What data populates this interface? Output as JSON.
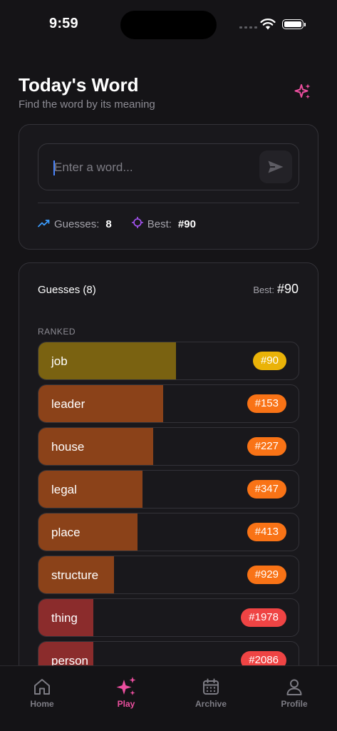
{
  "status": {
    "time": "9:59"
  },
  "header": {
    "title": "Today's Word",
    "subtitle": "Find the word by its meaning",
    "sparkle_icon": "sparkles-icon"
  },
  "input": {
    "placeholder": "Enter a word...",
    "value": ""
  },
  "stats": {
    "guesses_label": "Guesses:",
    "guesses_value": "8",
    "best_label": "Best:",
    "best_value": "#90"
  },
  "guesses": {
    "title": "Guesses (8)",
    "best_label": "Best:",
    "best_value": "#90",
    "section_label": "RANKED",
    "items": [
      {
        "word": "job",
        "rank": "#90",
        "fill": 0.53,
        "bar_color": "#7a6211",
        "badge_color": "#eab308"
      },
      {
        "word": "leader",
        "rank": "#153",
        "fill": 0.48,
        "bar_color": "#8b4219",
        "badge_color": "#f97316"
      },
      {
        "word": "house",
        "rank": "#227",
        "fill": 0.44,
        "bar_color": "#8b4219",
        "badge_color": "#f97316"
      },
      {
        "word": "legal",
        "rank": "#347",
        "fill": 0.4,
        "bar_color": "#8b4219",
        "badge_color": "#f97316"
      },
      {
        "word": "place",
        "rank": "#413",
        "fill": 0.38,
        "bar_color": "#8b4219",
        "badge_color": "#f97316"
      },
      {
        "word": "structure",
        "rank": "#929",
        "fill": 0.29,
        "bar_color": "#8b4219",
        "badge_color": "#f97316"
      },
      {
        "word": "thing",
        "rank": "#1978",
        "fill": 0.21,
        "bar_color": "#8b2c2c",
        "badge_color": "#ef4444"
      },
      {
        "word": "person",
        "rank": "#2086",
        "fill": 0.21,
        "bar_color": "#8b2c2c",
        "badge_color": "#ef4444"
      }
    ]
  },
  "tabs": [
    {
      "label": "Home",
      "icon": "home-icon",
      "active": false
    },
    {
      "label": "Play",
      "icon": "sparkles-icon",
      "active": true
    },
    {
      "label": "Archive",
      "icon": "calendar-icon",
      "active": false
    },
    {
      "label": "Profile",
      "icon": "user-icon",
      "active": false
    }
  ],
  "colors": {
    "accent": "#ec4f9f",
    "background": "#151417",
    "card": "#19181c",
    "cursor": "#4b86ff"
  }
}
